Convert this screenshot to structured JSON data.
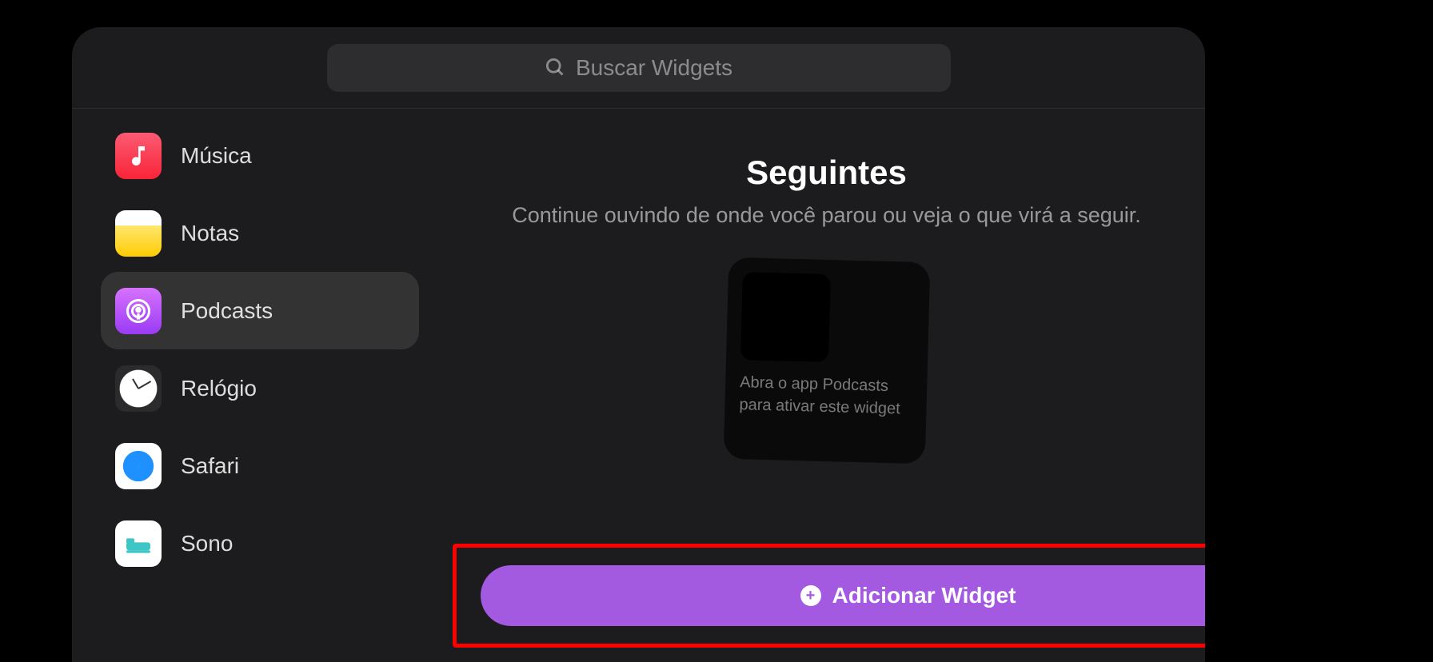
{
  "search": {
    "placeholder": "Buscar Widgets"
  },
  "sidebar": {
    "items": [
      {
        "label": "Música"
      },
      {
        "label": "Notas"
      },
      {
        "label": "Podcasts"
      },
      {
        "label": "Relógio"
      },
      {
        "label": "Safari"
      },
      {
        "label": "Sono"
      }
    ]
  },
  "main": {
    "title": "Seguintes",
    "subtitle": "Continue ouvindo de onde você parou ou veja o que virá a seguir.",
    "preview_text": "Abra o app Podcasts para ativar este widget",
    "add_button": "Adicionar Widget"
  }
}
